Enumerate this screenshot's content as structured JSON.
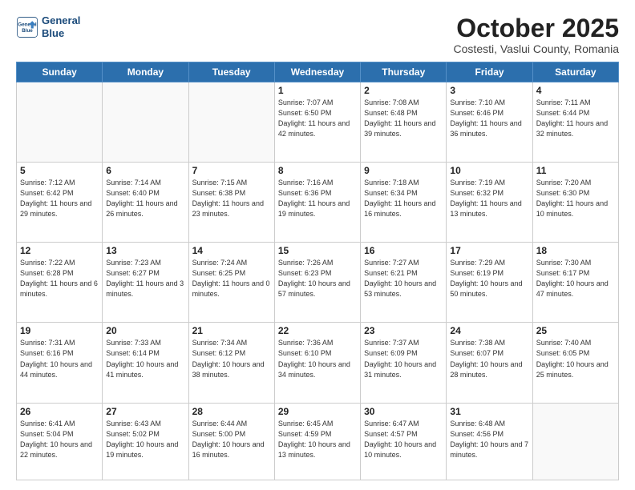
{
  "logo": {
    "line1": "General",
    "line2": "Blue"
  },
  "title": "October 2025",
  "subtitle": "Costesti, Vaslui County, Romania",
  "days_of_week": [
    "Sunday",
    "Monday",
    "Tuesday",
    "Wednesday",
    "Thursday",
    "Friday",
    "Saturday"
  ],
  "weeks": [
    [
      {
        "day": "",
        "info": ""
      },
      {
        "day": "",
        "info": ""
      },
      {
        "day": "",
        "info": ""
      },
      {
        "day": "1",
        "info": "Sunrise: 7:07 AM\nSunset: 6:50 PM\nDaylight: 11 hours\nand 42 minutes."
      },
      {
        "day": "2",
        "info": "Sunrise: 7:08 AM\nSunset: 6:48 PM\nDaylight: 11 hours\nand 39 minutes."
      },
      {
        "day": "3",
        "info": "Sunrise: 7:10 AM\nSunset: 6:46 PM\nDaylight: 11 hours\nand 36 minutes."
      },
      {
        "day": "4",
        "info": "Sunrise: 7:11 AM\nSunset: 6:44 PM\nDaylight: 11 hours\nand 32 minutes."
      }
    ],
    [
      {
        "day": "5",
        "info": "Sunrise: 7:12 AM\nSunset: 6:42 PM\nDaylight: 11 hours\nand 29 minutes."
      },
      {
        "day": "6",
        "info": "Sunrise: 7:14 AM\nSunset: 6:40 PM\nDaylight: 11 hours\nand 26 minutes."
      },
      {
        "day": "7",
        "info": "Sunrise: 7:15 AM\nSunset: 6:38 PM\nDaylight: 11 hours\nand 23 minutes."
      },
      {
        "day": "8",
        "info": "Sunrise: 7:16 AM\nSunset: 6:36 PM\nDaylight: 11 hours\nand 19 minutes."
      },
      {
        "day": "9",
        "info": "Sunrise: 7:18 AM\nSunset: 6:34 PM\nDaylight: 11 hours\nand 16 minutes."
      },
      {
        "day": "10",
        "info": "Sunrise: 7:19 AM\nSunset: 6:32 PM\nDaylight: 11 hours\nand 13 minutes."
      },
      {
        "day": "11",
        "info": "Sunrise: 7:20 AM\nSunset: 6:30 PM\nDaylight: 11 hours\nand 10 minutes."
      }
    ],
    [
      {
        "day": "12",
        "info": "Sunrise: 7:22 AM\nSunset: 6:28 PM\nDaylight: 11 hours\nand 6 minutes."
      },
      {
        "day": "13",
        "info": "Sunrise: 7:23 AM\nSunset: 6:27 PM\nDaylight: 11 hours\nand 3 minutes."
      },
      {
        "day": "14",
        "info": "Sunrise: 7:24 AM\nSunset: 6:25 PM\nDaylight: 11 hours\nand 0 minutes."
      },
      {
        "day": "15",
        "info": "Sunrise: 7:26 AM\nSunset: 6:23 PM\nDaylight: 10 hours\nand 57 minutes."
      },
      {
        "day": "16",
        "info": "Sunrise: 7:27 AM\nSunset: 6:21 PM\nDaylight: 10 hours\nand 53 minutes."
      },
      {
        "day": "17",
        "info": "Sunrise: 7:29 AM\nSunset: 6:19 PM\nDaylight: 10 hours\nand 50 minutes."
      },
      {
        "day": "18",
        "info": "Sunrise: 7:30 AM\nSunset: 6:17 PM\nDaylight: 10 hours\nand 47 minutes."
      }
    ],
    [
      {
        "day": "19",
        "info": "Sunrise: 7:31 AM\nSunset: 6:16 PM\nDaylight: 10 hours\nand 44 minutes."
      },
      {
        "day": "20",
        "info": "Sunrise: 7:33 AM\nSunset: 6:14 PM\nDaylight: 10 hours\nand 41 minutes."
      },
      {
        "day": "21",
        "info": "Sunrise: 7:34 AM\nSunset: 6:12 PM\nDaylight: 10 hours\nand 38 minutes."
      },
      {
        "day": "22",
        "info": "Sunrise: 7:36 AM\nSunset: 6:10 PM\nDaylight: 10 hours\nand 34 minutes."
      },
      {
        "day": "23",
        "info": "Sunrise: 7:37 AM\nSunset: 6:09 PM\nDaylight: 10 hours\nand 31 minutes."
      },
      {
        "day": "24",
        "info": "Sunrise: 7:38 AM\nSunset: 6:07 PM\nDaylight: 10 hours\nand 28 minutes."
      },
      {
        "day": "25",
        "info": "Sunrise: 7:40 AM\nSunset: 6:05 PM\nDaylight: 10 hours\nand 25 minutes."
      }
    ],
    [
      {
        "day": "26",
        "info": "Sunrise: 6:41 AM\nSunset: 5:04 PM\nDaylight: 10 hours\nand 22 minutes."
      },
      {
        "day": "27",
        "info": "Sunrise: 6:43 AM\nSunset: 5:02 PM\nDaylight: 10 hours\nand 19 minutes."
      },
      {
        "day": "28",
        "info": "Sunrise: 6:44 AM\nSunset: 5:00 PM\nDaylight: 10 hours\nand 16 minutes."
      },
      {
        "day": "29",
        "info": "Sunrise: 6:45 AM\nSunset: 4:59 PM\nDaylight: 10 hours\nand 13 minutes."
      },
      {
        "day": "30",
        "info": "Sunrise: 6:47 AM\nSunset: 4:57 PM\nDaylight: 10 hours\nand 10 minutes."
      },
      {
        "day": "31",
        "info": "Sunrise: 6:48 AM\nSunset: 4:56 PM\nDaylight: 10 hours\nand 7 minutes."
      },
      {
        "day": "",
        "info": ""
      }
    ]
  ]
}
